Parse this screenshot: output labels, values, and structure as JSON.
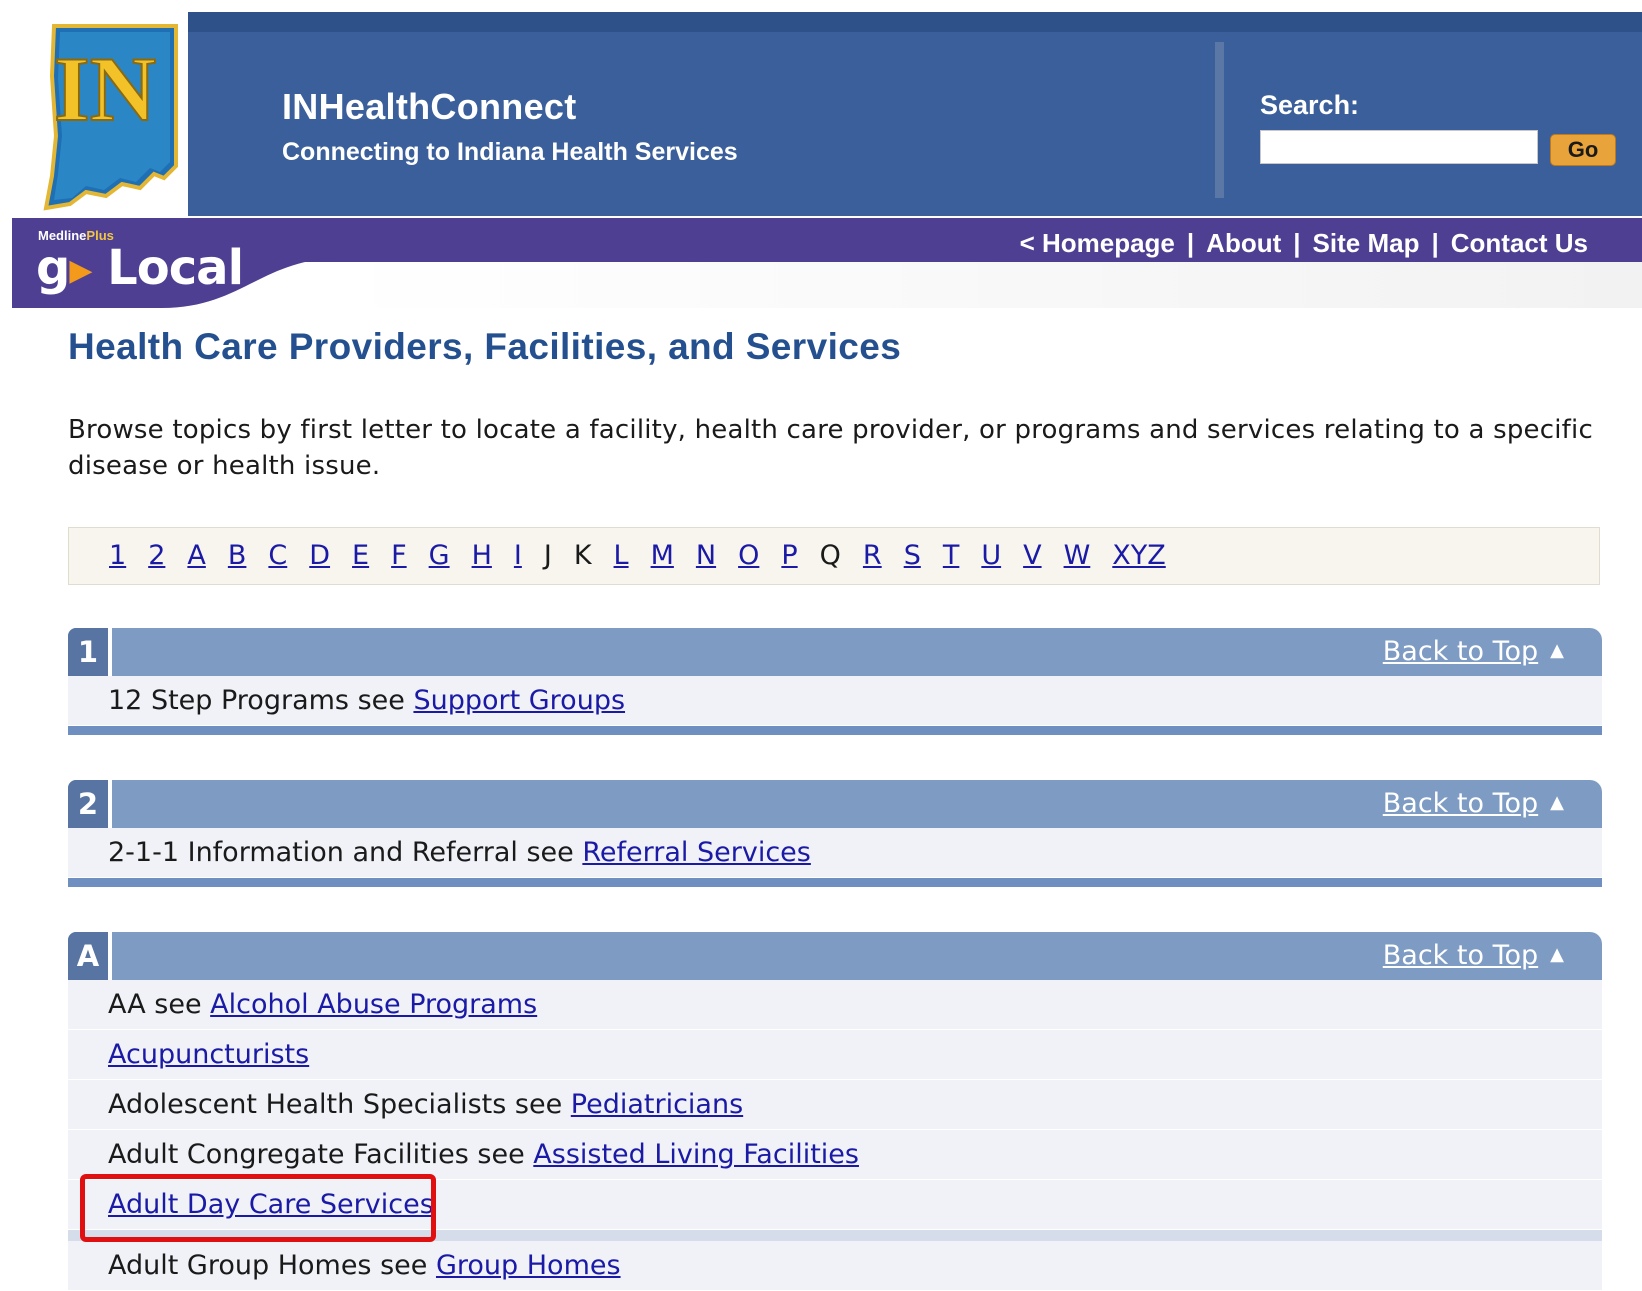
{
  "header": {
    "logo_text": "IN",
    "site_title": "INHealthConnect",
    "site_subtitle": "Connecting to Indiana Health Services",
    "search_label": "Search:",
    "search_value": "",
    "go_label": "Go"
  },
  "golocal": {
    "small_a": "Medline",
    "small_b": "Plus",
    "main_a": "g",
    "main_b": "Local"
  },
  "nav": {
    "homepage": "< Homepage",
    "about": "About",
    "sitemap": "Site Map",
    "contact": "Contact Us",
    "sep": "|"
  },
  "page": {
    "title": "Health Care Providers, Facilities, and Services",
    "intro": "Browse topics by first letter to locate a facility, health care provider, or programs and services relating to a specific disease or health issue."
  },
  "letters": [
    {
      "label": "1",
      "link": true
    },
    {
      "label": "2",
      "link": true
    },
    {
      "label": "A",
      "link": true
    },
    {
      "label": "B",
      "link": true
    },
    {
      "label": "C",
      "link": true
    },
    {
      "label": "D",
      "link": true
    },
    {
      "label": "E",
      "link": true
    },
    {
      "label": "F",
      "link": true
    },
    {
      "label": "G",
      "link": true
    },
    {
      "label": "H",
      "link": true
    },
    {
      "label": "I",
      "link": true
    },
    {
      "label": "J",
      "link": false
    },
    {
      "label": "K",
      "link": false
    },
    {
      "label": "L",
      "link": true
    },
    {
      "label": "M",
      "link": true
    },
    {
      "label": "N",
      "link": true
    },
    {
      "label": "O",
      "link": true
    },
    {
      "label": "P",
      "link": true
    },
    {
      "label": "Q",
      "link": false
    },
    {
      "label": "R",
      "link": true
    },
    {
      "label": "S",
      "link": true
    },
    {
      "label": "T",
      "link": true
    },
    {
      "label": "U",
      "link": true
    },
    {
      "label": "V",
      "link": true
    },
    {
      "label": "W",
      "link": true
    },
    {
      "label": "XYZ",
      "link": true
    }
  ],
  "back_to_top": "Back to Top",
  "sections": {
    "s1": {
      "letter": "1",
      "rows": [
        {
          "text": "12 Step Programs see ",
          "link": "Support Groups"
        }
      ]
    },
    "s2": {
      "letter": "2",
      "rows": [
        {
          "text": "2-1-1 Information and Referral see ",
          "link": "Referral Services"
        }
      ]
    },
    "sA": {
      "letter": "A",
      "rows": [
        {
          "text": "AA see ",
          "link": "Alcohol Abuse Programs"
        },
        {
          "text": "",
          "link": "Acupuncturists"
        },
        {
          "text": "Adolescent Health Specialists see ",
          "link": "Pediatricians"
        },
        {
          "text": "Adult Congregate Facilities see ",
          "link": "Assisted Living Facilities"
        },
        {
          "text": "",
          "link": "Adult Day Care Services"
        },
        {
          "text": "Adult Group Homes see ",
          "link": "Group Homes"
        }
      ]
    }
  },
  "colors": {
    "header_blue": "#3a5f9a",
    "nav_purple": "#4e3f93",
    "section_head": "#7e9cc3",
    "title_blue": "#24508f",
    "highlight_red": "#e01010"
  }
}
